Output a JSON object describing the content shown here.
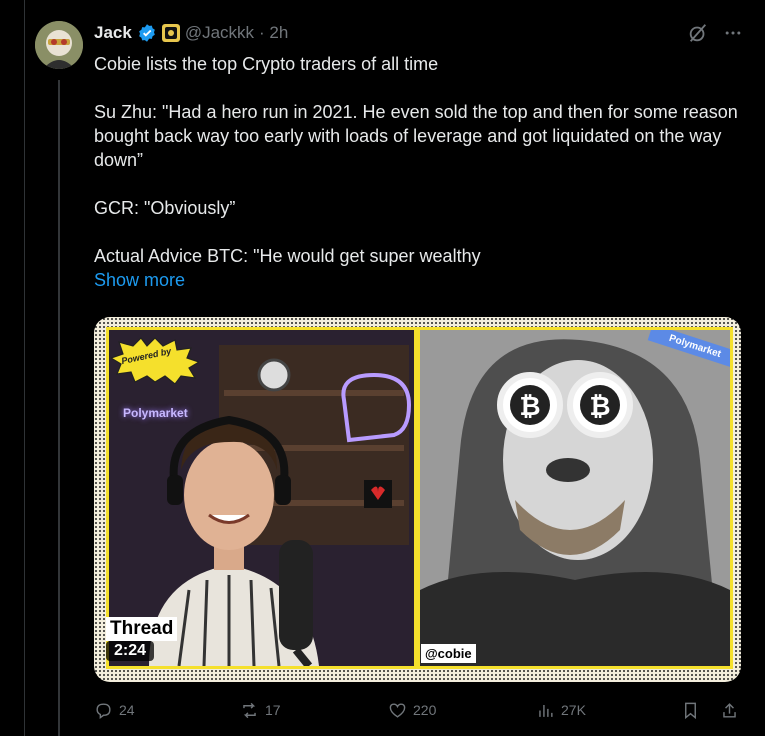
{
  "tweet": {
    "author_name": "Jack",
    "handle": "@Jackkk",
    "time": "· 2h",
    "paragraphs": [
      "Cobie lists the top Crypto traders of all time",
      "Su Zhu: \"Had a hero run in 2021. He even sold the top and then for some reason bought back way too early with loads of leverage and got liquidated on the way down”",
      "GCR: \"Obviously”",
      "Actual Advice BTC: \"He would get super wealthy"
    ],
    "show_more": "Show more"
  },
  "media": {
    "powered_by": "Powered by",
    "polymarket_corner": "Polymarket",
    "polymarket_sign": "Polymarket",
    "thread_label": "Thread",
    "duration": "2:24",
    "cobie_tag": "@cobie"
  },
  "actions": {
    "replies": "24",
    "reposts": "17",
    "likes": "220",
    "views": "27K"
  },
  "icons": [
    "verified-badge-icon",
    "affiliate-badge-icon",
    "grok-icon",
    "more-icon",
    "reply-icon",
    "repost-icon",
    "like-icon",
    "views-icon",
    "bookmark-icon",
    "share-icon"
  ],
  "colors": {
    "accent": "#1d9bf0",
    "background": "#000000",
    "muted": "#71767b",
    "frame": "#f5e02c"
  }
}
